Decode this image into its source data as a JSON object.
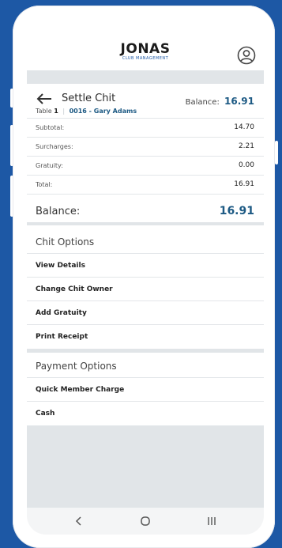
{
  "app": {
    "logo_main": "JONAS",
    "logo_sub": "CLUB MANAGEMENT"
  },
  "header": {
    "title": "Settle Chit",
    "table_label": "Table",
    "table_number": "1",
    "member": "0016 - Gary Adams",
    "balance_label": "Balance:",
    "balance_value": "16.91"
  },
  "summary": [
    {
      "label": "Subtotal:",
      "value": "14.70"
    },
    {
      "label": "Surcharges:",
      "value": "2.21"
    },
    {
      "label": "Gratuity:",
      "value": "0.00"
    },
    {
      "label": "Total:",
      "value": "16.91"
    }
  ],
  "balance": {
    "label": "Balance:",
    "value": "16.91"
  },
  "chit_options": {
    "title": "Chit Options",
    "items": [
      "View Details",
      "Change Chit Owner",
      "Add Gratuity",
      "Print Receipt"
    ]
  },
  "payment_options": {
    "title": "Payment Options",
    "items": [
      "Quick Member Charge",
      "Cash"
    ]
  },
  "icons": {
    "user": "user-circle-icon",
    "back": "arrow-left-icon",
    "nav_back": "chevron-left-icon",
    "nav_home": "circle-home-icon",
    "nav_recents": "recents-icon"
  },
  "colors": {
    "background": "#1d58a5",
    "accent": "#1d5a84",
    "divider": "#e1e5e8"
  }
}
